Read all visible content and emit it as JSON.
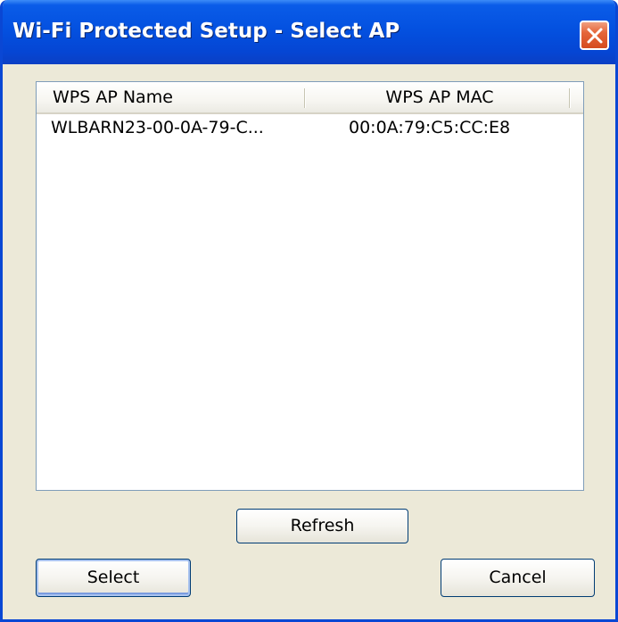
{
  "window": {
    "title": "Wi-Fi Protected Setup - Select AP",
    "close_icon": "close-x-icon"
  },
  "list": {
    "columns": [
      "WPS AP Name",
      "WPS AP MAC"
    ],
    "rows": [
      {
        "name": "WLBARN23-00-0A-79-C...",
        "mac": "00:0A:79:C5:CC:E8"
      }
    ]
  },
  "buttons": {
    "refresh": "Refresh",
    "select": "Select",
    "cancel": "Cancel"
  },
  "colors": {
    "titlebar": "#0451e0",
    "window_bg": "#ece9d8",
    "close_button": "#d54b1f"
  }
}
